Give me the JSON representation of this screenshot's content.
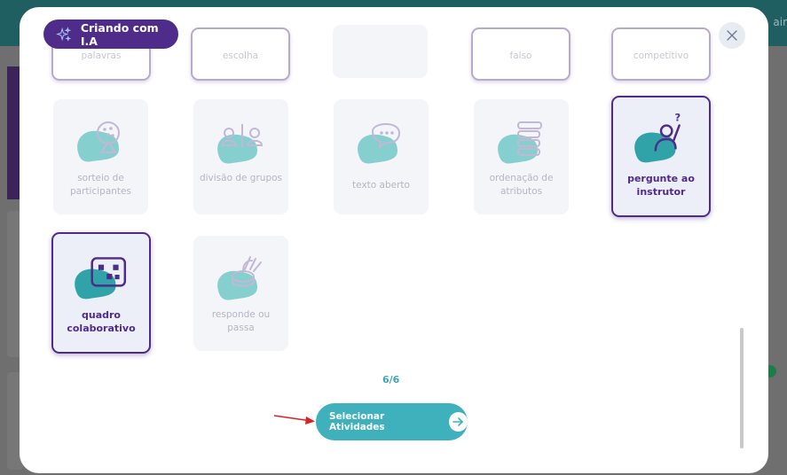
{
  "background": {
    "header_text": "air"
  },
  "modal": {
    "ai_badge_label": "Criando com I.A",
    "page_indicator": "6/6",
    "select_button_label": "Selecionar Atividades"
  },
  "top_row": [
    {
      "label": "palavras"
    },
    {
      "label": "escolha"
    },
    {
      "label": ""
    },
    {
      "label": "falso"
    },
    {
      "label": "competitivo"
    }
  ],
  "activities": [
    {
      "label": "sorteio de participantes",
      "icon": "raffle-wheel-icon",
      "selected": false
    },
    {
      "label": "divisão de grupos",
      "icon": "group-division-icon",
      "selected": false
    },
    {
      "label": "texto aberto",
      "icon": "speech-bubble-icon",
      "selected": false
    },
    {
      "label": "ordenação de atributos",
      "icon": "stacked-bars-icon",
      "selected": false
    },
    {
      "label": "pergunte ao instrutor",
      "icon": "ask-instructor-icon",
      "selected": true
    },
    {
      "label": "quadro colaborativo",
      "icon": "collaborative-board-icon",
      "selected": true
    },
    {
      "label": "responde ou passa",
      "icon": "hand-stop-icon",
      "selected": false
    }
  ],
  "colors": {
    "accent_purple": "#4f2b8a",
    "teal": "#3fb1bc",
    "blob": "#86cfcf"
  }
}
